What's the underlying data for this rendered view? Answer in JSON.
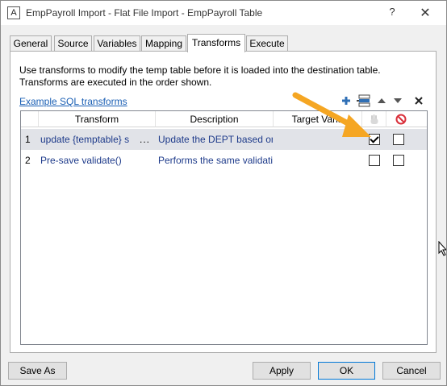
{
  "window": {
    "app_icon_letter": "A",
    "title": "EmpPayroll Import - Flat File Import - EmpPayroll Table",
    "help_label": "?",
    "close_label": "✕"
  },
  "tabs": [
    {
      "label": "General",
      "active": false
    },
    {
      "label": "Source",
      "active": false
    },
    {
      "label": "Variables",
      "active": false
    },
    {
      "label": "Mapping",
      "active": false
    },
    {
      "label": "Transforms",
      "active": true
    },
    {
      "label": "Execute",
      "active": false
    }
  ],
  "transforms_panel": {
    "description_line1": "Use transforms to modify the temp table before it is loaded into the destination table.",
    "description_line2": "Transforms are executed in the order shown.",
    "example_link": "Example SQL transforms",
    "toolbar_icons": [
      "add-icon",
      "insert-icon",
      "move-up-icon",
      "move-down-icon",
      "delete-icon"
    ],
    "grid": {
      "columns": [
        "Transform",
        "Description",
        "Target Varia"
      ],
      "header_icons": [
        "hand-icon",
        "disabled-icon"
      ],
      "rows": [
        {
          "num": "1",
          "transform": "update {temptable} s",
          "ellipsis": "...",
          "description": "Update the DEPT based on",
          "target": "",
          "check1": true,
          "check2": false,
          "selected": true
        },
        {
          "num": "2",
          "transform": "Pre-save validate()",
          "ellipsis": "",
          "description": "Performs the same validatio",
          "target": "",
          "check1": false,
          "check2": false,
          "selected": false
        }
      ]
    }
  },
  "buttons": {
    "save_as": "Save As",
    "apply": "Apply",
    "ok": "OK",
    "cancel": "Cancel"
  },
  "colors": {
    "link": "#1a5fb4",
    "annotation_arrow": "#f5a623",
    "toolbar_blue": "#2f6fb5",
    "disabled_red": "#d9303b"
  }
}
